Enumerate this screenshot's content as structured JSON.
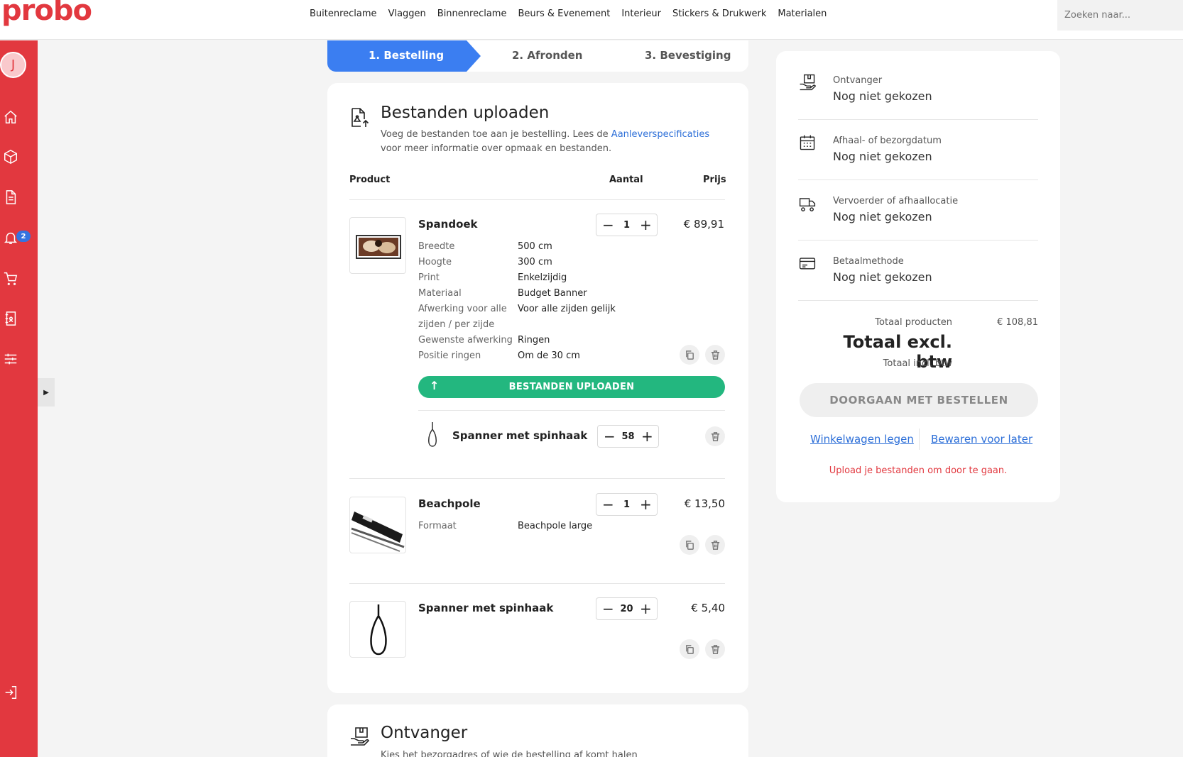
{
  "brand": {
    "logo": "probo",
    "accent": "#e2383f"
  },
  "topnav": {
    "items": [
      "Buitenreclame",
      "Vlaggen",
      "Binnenreclame",
      "Beurs & Evenement",
      "Interieur",
      "Stickers & Drukwerk",
      "Materialen"
    ],
    "search_placeholder": "Zoeken naar..."
  },
  "sidebar": {
    "avatar_initial": "J",
    "notification_count": "2",
    "icons": [
      "home-icon",
      "package-icon",
      "document-icon",
      "bell-icon",
      "cart-icon",
      "address-book-icon",
      "sliders-icon",
      "logout-icon"
    ]
  },
  "steps": {
    "s1": "1. Bestelling",
    "s2": "2. Afronden",
    "s3": "3. Bevestiging"
  },
  "upload": {
    "title": "Bestanden uploaden",
    "desc_before": "Voeg de bestanden toe aan je bestelling. Lees de ",
    "desc_link": "Aanleverspecificaties",
    "desc_after": " voor meer informatie over opmaak en bestanden.",
    "th_product": "Product",
    "th_qty": "Aantal",
    "th_price": "Prijs",
    "upload_button": "BESTANDEN UPLOADEN"
  },
  "products": [
    {
      "name": "Spandoek",
      "qty": "1",
      "price": "€ 89,91",
      "specs": [
        {
          "k": "Breedte",
          "v": "500 cm"
        },
        {
          "k": "Hoogte",
          "v": "300 cm"
        },
        {
          "k": "Print",
          "v": "Enkelzijdig"
        },
        {
          "k": "Materiaal",
          "v": "Budget Banner"
        },
        {
          "k": "Afwerking voor alle",
          "v": "Voor alle zijden gelijk"
        },
        {
          "k": "zijden / per zijde",
          "v": ""
        },
        {
          "k": "Gewenste afwerking",
          "v": "Ringen"
        },
        {
          "k": "Positie ringen",
          "v": "Om de 30 cm"
        }
      ],
      "accessory": {
        "name": "Spanner met spinhaak",
        "qty": "58"
      }
    },
    {
      "name": "Beachpole",
      "qty": "1",
      "price": "€ 13,50",
      "specs": [
        {
          "k": "Formaat",
          "v": "Beachpole large"
        }
      ]
    },
    {
      "name": "Spanner met spinhaak",
      "qty": "20",
      "price": "€ 5,40"
    }
  ],
  "recipient_section": {
    "title": "Ontvanger",
    "desc": "Kies het bezorgadres of wie de bestelling af komt halen"
  },
  "summary": {
    "rows": [
      {
        "label": "Ontvanger",
        "value": "Nog niet gekozen",
        "icon": "receiver-icon"
      },
      {
        "label": "Afhaal- of bezorgdatum",
        "value": "Nog niet gekozen",
        "icon": "calendar-icon"
      },
      {
        "label": "Vervoerder of afhaallocatie",
        "value": "Nog niet gekozen",
        "icon": "truck-icon"
      },
      {
        "label": "Betaalmethode",
        "value": "Nog niet gekozen",
        "icon": "card-icon"
      }
    ],
    "total_products_label": "Totaal producten",
    "total_products_value": "€ 108,81",
    "total_excl_label": "Totaal excl. btw",
    "total_incl_label": "Totaal incl. btw",
    "continue_button": "DOORGAAN MET BESTELLEN",
    "clear_cart": "Winkelwagen legen",
    "save_later": "Bewaren voor later",
    "warning": "Upload je bestanden om door te gaan."
  }
}
